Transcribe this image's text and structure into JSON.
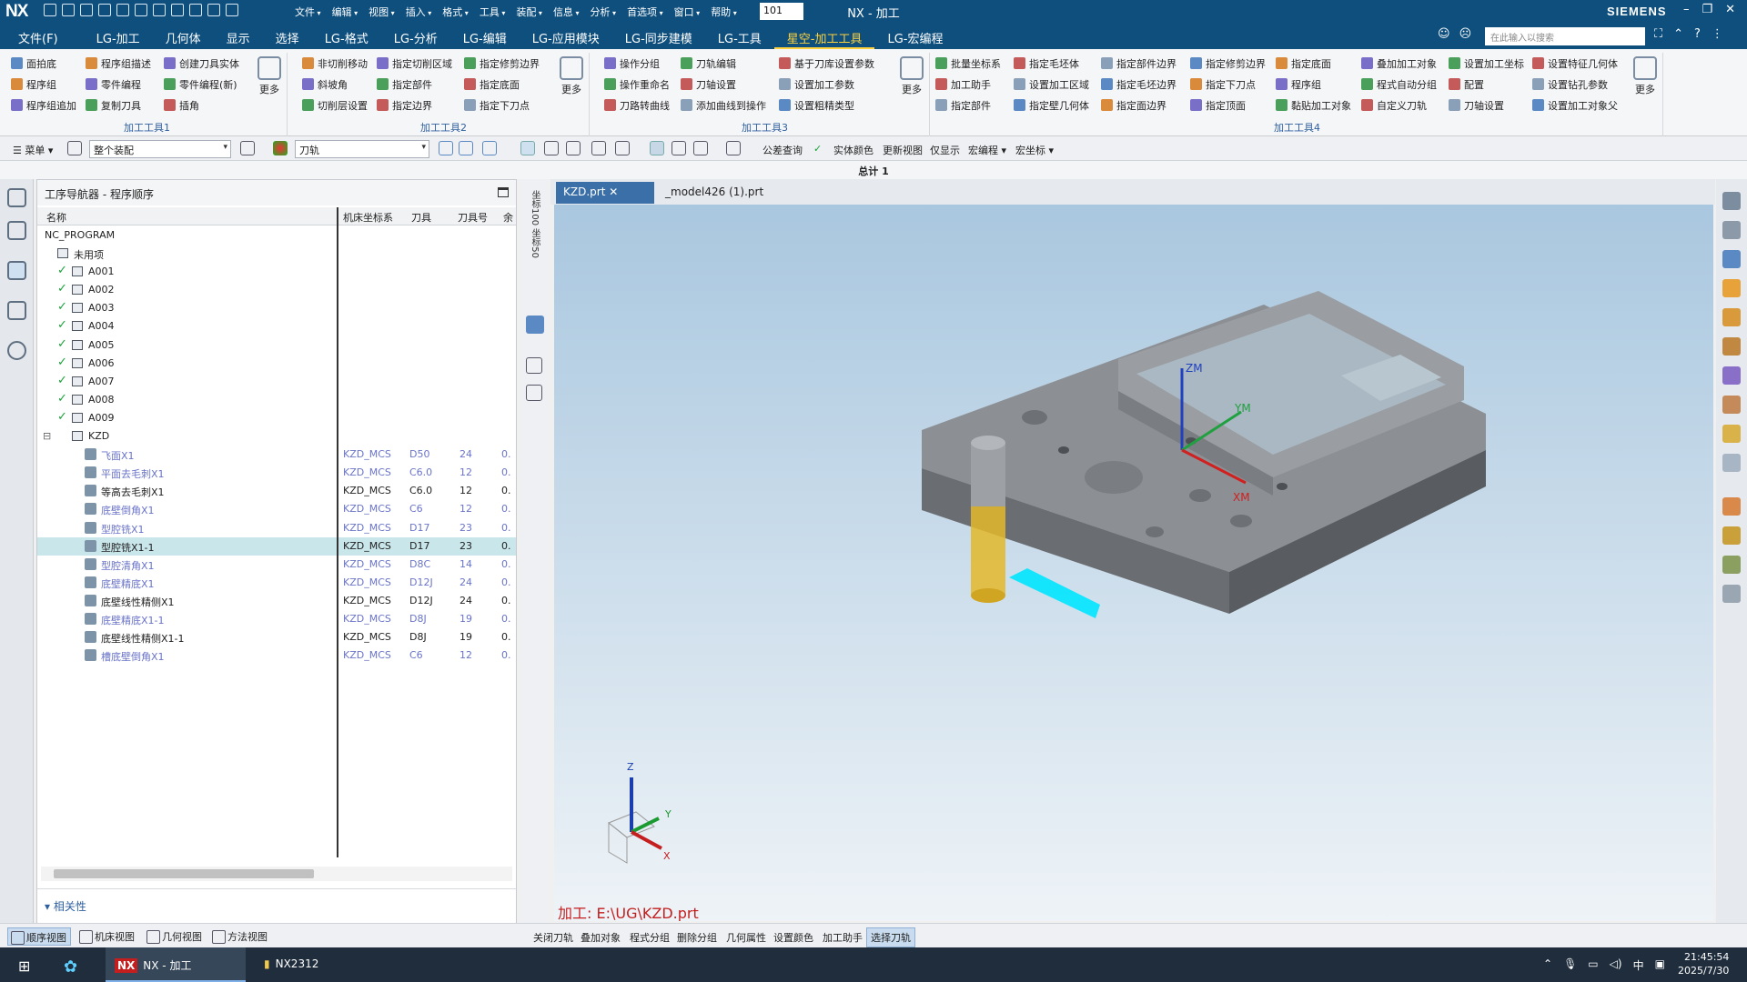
{
  "titlebar": {
    "logo": "NX",
    "menus": [
      "文件",
      "编辑",
      "视图",
      "插入",
      "格式",
      "工具",
      "装配",
      "信息",
      "分析",
      "首选项",
      "窗口",
      "帮助"
    ],
    "zoom_value": "101",
    "window_title": "NX - 加工",
    "brand": "SIEMENS"
  },
  "tabbar": {
    "tabs": [
      "文件(F)",
      "LG-加工",
      "几何体",
      "显示",
      "选择",
      "LG-格式",
      "LG-分析",
      "LG-编辑",
      "LG-应用模块",
      "LG-同步建模",
      "LG-工具",
      "星空-加工工具",
      "LG-宏编程"
    ],
    "active_tab": "星空-加工工具",
    "search_placeholder": "在此输入以搜索"
  },
  "ribbon": {
    "groups": [
      {
        "label": "加工工具1",
        "cols": [
          [
            "面拍底",
            "程序组",
            "程序组追加"
          ],
          [
            "程序组描述",
            "零件编程",
            "复制刀具"
          ],
          [
            "创建刀具实体",
            "零件编程(新)",
            "插角"
          ]
        ]
      },
      {
        "label": "加工工具2",
        "cols": [
          [
            "非切削移动",
            "斜坡角",
            "切削层设置"
          ],
          [
            "指定切削区域",
            "指定部件",
            "指定边界"
          ],
          [
            "指定修剪边界",
            "指定底面",
            "指定下刀点"
          ]
        ]
      },
      {
        "label": "加工工具3",
        "cols": [
          [
            "操作分组",
            "操作重命名",
            "刀路转曲线"
          ],
          [
            "刀轨编辑",
            "刀轴设置",
            "添加曲线到操作"
          ],
          [
            "基于刀库设置参数",
            "设置加工参数",
            "设置粗精类型"
          ]
        ]
      },
      {
        "label": "加工工具4",
        "cols": [
          [
            "批量坐标系",
            "加工助手",
            "指定部件"
          ],
          [
            "指定毛坯体",
            "设置加工区域",
            "指定壁几何体"
          ],
          [
            "指定部件边界",
            "指定毛坯边界",
            "指定面边界"
          ],
          [
            "指定修剪边界",
            "指定下刀点",
            "指定顶面"
          ],
          [
            "指定底面",
            "程序组",
            "黏贴加工对象"
          ],
          [
            "叠加加工对象",
            "程式自动分组",
            "自定义刀轨"
          ],
          [
            "设置加工坐标",
            "配置",
            "刀轴设置"
          ],
          [
            "设置特征几何体",
            "设置钻孔参数",
            "设置加工对象父"
          ]
        ]
      }
    ],
    "more_label": "更多"
  },
  "cmdbar": {
    "menu_label": "菜单",
    "assembly_filter": "整个装配",
    "type_filter": "刀轨",
    "items": [
      "公差查询",
      "实体颜色",
      "更新视图",
      "仅显示",
      "宏编程",
      "宏坐标"
    ]
  },
  "total_label": "总计 1",
  "navigator": {
    "title": "工序导航器 - 程序顺序",
    "columns": [
      "名称",
      "机床坐标系",
      "刀具",
      "刀具号",
      "余"
    ],
    "rows": [
      {
        "name": "NC_PROGRAM",
        "indent": 0,
        "kind": "root"
      },
      {
        "name": "未用项",
        "indent": 1,
        "kind": "folder"
      },
      {
        "name": "A001",
        "indent": 1,
        "kind": "program"
      },
      {
        "name": "A002",
        "indent": 1,
        "kind": "program"
      },
      {
        "name": "A003",
        "indent": 1,
        "kind": "program"
      },
      {
        "name": "A004",
        "indent": 1,
        "kind": "program"
      },
      {
        "name": "A005",
        "indent": 1,
        "kind": "program"
      },
      {
        "name": "A006",
        "indent": 1,
        "kind": "program"
      },
      {
        "name": "A007",
        "indent": 1,
        "kind": "program"
      },
      {
        "name": "A008",
        "indent": 1,
        "kind": "program"
      },
      {
        "name": "A009",
        "indent": 1,
        "kind": "program"
      },
      {
        "name": "KZD",
        "indent": 1,
        "kind": "group"
      },
      {
        "name": "飞面X1",
        "mcs": "KZD_MCS",
        "tool": "D50",
        "num": "24",
        "stock": "0.",
        "kind": "op",
        "blue": true
      },
      {
        "name": "平面去毛刺X1",
        "mcs": "KZD_MCS",
        "tool": "C6.0",
        "num": "12",
        "stock": "0.",
        "kind": "op",
        "blue": true
      },
      {
        "name": "等高去毛刺X1",
        "mcs": "KZD_MCS",
        "tool": "C6.0",
        "num": "12",
        "stock": "0.",
        "kind": "op",
        "blue": false
      },
      {
        "name": "底壁倒角X1",
        "mcs": "KZD_MCS",
        "tool": "C6",
        "num": "12",
        "stock": "0.",
        "kind": "op",
        "blue": true
      },
      {
        "name": "型腔铣X1",
        "mcs": "KZD_MCS",
        "tool": "D17",
        "num": "23",
        "stock": "0.",
        "kind": "op",
        "blue": true
      },
      {
        "name": "型腔铣X1-1",
        "mcs": "KZD_MCS",
        "tool": "D17",
        "num": "23",
        "stock": "0.",
        "kind": "op",
        "blue": false,
        "selected": true
      },
      {
        "name": "型腔清角X1",
        "mcs": "KZD_MCS",
        "tool": "D8C",
        "num": "14",
        "stock": "0.",
        "kind": "op",
        "blue": true
      },
      {
        "name": "底壁精底X1",
        "mcs": "KZD_MCS",
        "tool": "D12J",
        "num": "24",
        "stock": "0.",
        "kind": "op",
        "blue": true
      },
      {
        "name": "底壁线性精侧X1",
        "mcs": "KZD_MCS",
        "tool": "D12J",
        "num": "24",
        "stock": "0.",
        "kind": "op",
        "blue": false
      },
      {
        "name": "底壁精底X1-1",
        "mcs": "KZD_MCS",
        "tool": "D8J",
        "num": "19",
        "stock": "0.",
        "kind": "op",
        "blue": true
      },
      {
        "name": "底壁线性精侧X1-1",
        "mcs": "KZD_MCS",
        "tool": "D8J",
        "num": "19",
        "stock": "0.",
        "kind": "op",
        "blue": false
      },
      {
        "name": "槽底壁倒角X1",
        "mcs": "KZD_MCS",
        "tool": "C6",
        "num": "12",
        "stock": "0.",
        "kind": "op",
        "blue": true
      }
    ],
    "related_label": "相关性"
  },
  "midstrip": {
    "text": "坐标100 坐标50"
  },
  "graphics": {
    "tabs": [
      {
        "label": "KZD.prt",
        "active": true
      },
      {
        "label": "_model426 (1).prt",
        "active": false
      }
    ],
    "status_path": "加工: E:\\UG\\KZD.prt",
    "wcs_labels": [
      "ZM",
      "YM",
      "XM"
    ],
    "triad_labels": [
      "Z",
      "Y",
      "X"
    ]
  },
  "bottombar": {
    "views": [
      "顺序视图",
      "机床视图",
      "几何视图",
      "方法视图"
    ],
    "active_view": "顺序视图",
    "actions": [
      "关闭刀轨",
      "叠加对象",
      "程式分组",
      "删除分组",
      "几何属性",
      "设置颜色",
      "加工助手",
      "选择刀轨"
    ],
    "active_action": "选择刀轨"
  },
  "taskbar": {
    "apps": [
      "NX - 加工",
      "NX2312"
    ],
    "ime": "中",
    "time": "21:45:54",
    "date": "2025/7/30"
  },
  "colors": {
    "accent": "#0e4f7e",
    "active_tab": "#ffd23c",
    "selection": "#c9e6ea",
    "op_blue": "#6a74c9",
    "path_red": "#c41e1e"
  }
}
